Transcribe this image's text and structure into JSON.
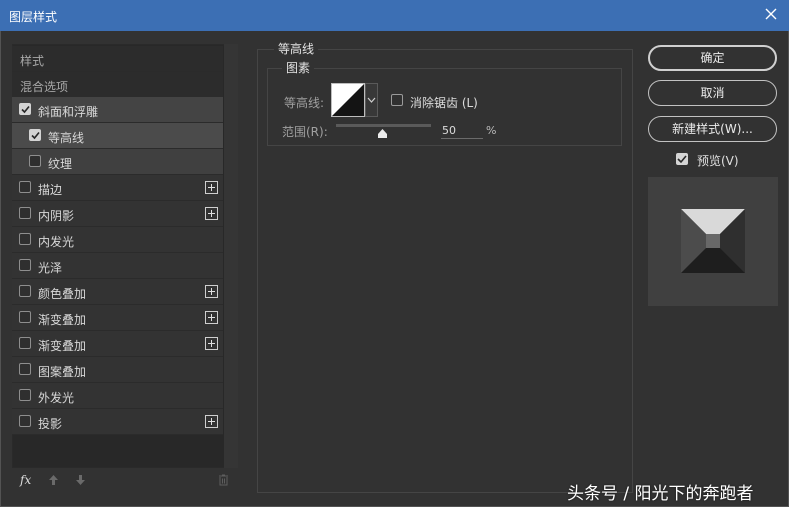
{
  "window": {
    "title": "图层样式"
  },
  "left_panel": {
    "items": [
      {
        "label": "样式",
        "type": "header"
      },
      {
        "label": "混合选项",
        "type": "header"
      },
      {
        "label": "斜面和浮雕",
        "checked": true,
        "plus": false
      },
      {
        "label": "等高线",
        "checked": true,
        "plus": false
      },
      {
        "label": "纹理",
        "checked": false,
        "plus": false
      },
      {
        "label": "描边",
        "checked": false,
        "plus": true
      },
      {
        "label": "内阴影",
        "checked": false,
        "plus": true
      },
      {
        "label": "内发光",
        "checked": false,
        "plus": false
      },
      {
        "label": "光泽",
        "checked": false,
        "plus": false
      },
      {
        "label": "颜色叠加",
        "checked": false,
        "plus": true
      },
      {
        "label": "渐变叠加",
        "checked": false,
        "plus": true
      },
      {
        "label": "渐变叠加",
        "checked": false,
        "plus": true
      },
      {
        "label": "图案叠加",
        "checked": false,
        "plus": false
      },
      {
        "label": "外发光",
        "checked": false,
        "plus": false
      },
      {
        "label": "投影",
        "checked": false,
        "plus": true
      }
    ],
    "toolbar": {
      "fx_label": "fx"
    }
  },
  "contour_panel": {
    "group_title": "等高线",
    "subgroup_title": "图素",
    "contour_label": "等高线:",
    "antialias_label": "消除锯齿 (L)",
    "antialias_checked": false,
    "range_label": "范围(R):",
    "range_value": "50",
    "range_unit": "%",
    "range_percent": 50
  },
  "buttons": {
    "ok": "确定",
    "cancel": "取消",
    "new_style": "新建样式(W)..."
  },
  "preview": {
    "label": "预览(V)",
    "checked": true
  },
  "watermark": "头条号 / 阳光下的奔跑者",
  "colors": {
    "titlebar": "#3c6fb4",
    "background": "#323232"
  }
}
